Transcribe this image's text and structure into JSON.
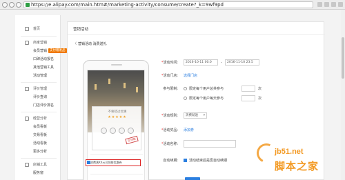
{
  "browser": {
    "url": "https://e.alipay.com/main.htm#/marketing-activity/consume/create?_k=9wf9pd"
  },
  "sidebar": {
    "home": "首页",
    "group_marketing": "商家营销",
    "item_member_marketing": "会员营销",
    "badge_paid": "支付赠发品",
    "item_koubei_signup": "口碑活动报名",
    "item_other_tools": "其他营销工具",
    "item_activity_manage": "活动管理",
    "group_review": "评价管理",
    "item_review_query": "评价查询",
    "item_store_rank": "门店评价排名",
    "group_analysis": "经营分析",
    "item_member_board": "会员看板",
    "item_trade_board": "交易看板",
    "item_activity_board": "活动看板",
    "item_more_analysis": "更多分析",
    "group_tools": "店铺工具",
    "item_service_shop": "服务窗"
  },
  "main": {
    "title": "营销活动",
    "breadcrumb": "营销活动 消费送礼",
    "back_arrow": "〈"
  },
  "phone": {
    "coupon_title": "不要错过优惠",
    "stars": "★★★★★",
    "coupon_sub": "",
    "stamp": "已领取",
    "link_text": "",
    "highlight_text": "消费满XX元可领取优惠券"
  },
  "form": {
    "time_label": "活动时间:",
    "time_start": "2016-10-11 00:0",
    "time_sep": "-",
    "time_end": "2016-11-10 23:5",
    "store_label": "活动门店:",
    "store_link": "选择门店",
    "limit_label": "参与限制:",
    "limit_opt1": "限定每个用户总共参与",
    "limit_opt2": "限定每个用户每天参与",
    "limit_unit": "次",
    "rule_label": "活动规则:",
    "rule_select": "消费就送",
    "prize_label": "活动奖品:",
    "prize_link": "添加券",
    "name_label": "活动名称:",
    "name_placeholder": "",
    "auto_label": "自动续期:",
    "auto_text": "活动结束后是否自动续期"
  },
  "watermark": {
    "domain": "jb51.net",
    "name": "脚本之家"
  },
  "colors": {
    "accent": "#2b7fe0",
    "badge": "#f07800",
    "highlight_border": "#dd2222",
    "watermark": "#f39a24"
  }
}
